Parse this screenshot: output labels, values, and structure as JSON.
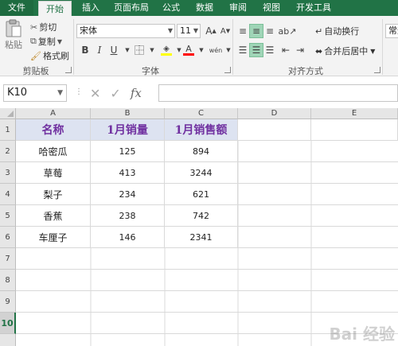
{
  "tabs": [
    "文件",
    "开始",
    "插入",
    "页面布局",
    "公式",
    "数据",
    "审阅",
    "视图",
    "开发工具"
  ],
  "clipboard": {
    "paste": "粘贴",
    "cut": "剪切",
    "copy": "复制",
    "format_painter": "格式刷",
    "group": "剪贴板"
  },
  "font": {
    "name": "宋体",
    "size": "11",
    "bold": "B",
    "italic": "I",
    "underline": "U",
    "increase": "A",
    "decrease": "A",
    "group": "字体"
  },
  "alignment": {
    "wrap_text": "自动换行",
    "merge_center": "合并后居中",
    "group": "对齐方式"
  },
  "number": {
    "format": "常规"
  },
  "formula_bar": {
    "name_box": "K10",
    "fx": "fx",
    "formula": ""
  },
  "columns": [
    "A",
    "B",
    "C",
    "D",
    "E"
  ],
  "rows": [
    "1",
    "2",
    "3",
    "4",
    "5",
    "6",
    "7",
    "8",
    "9",
    "10"
  ],
  "table": {
    "headers": [
      "名称",
      "1月销量",
      "1月销售额"
    ],
    "rows": [
      [
        "哈密瓜",
        "125",
        "894"
      ],
      [
        "草莓",
        "413",
        "3244"
      ],
      [
        "梨子",
        "234",
        "621"
      ],
      [
        "香蕉",
        "238",
        "742"
      ],
      [
        "车厘子",
        "146",
        "2341"
      ]
    ]
  },
  "colors": {
    "accent": "#217346",
    "header_fill": "#dde3f1",
    "header_text": "#7030a0"
  },
  "watermark": "Bai 经验"
}
